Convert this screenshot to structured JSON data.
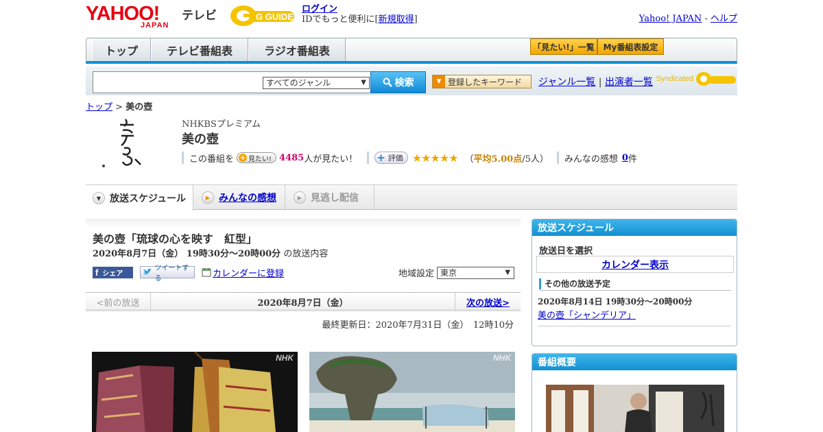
{
  "header": {
    "logo_text": "YAHOO!",
    "logo_sub": "JAPAN",
    "service": "テレビ",
    "partner_logo": "G GUIDE",
    "login": "ログイン",
    "login_desc": "IDでもっと便利に[",
    "signup": "新規取得",
    "login_desc_end": "]",
    "yahoo_japan": "Yahoo! JAPAN",
    "separator": "-",
    "help": "ヘルプ"
  },
  "nav": {
    "tabs": [
      "トップ",
      "テレビ番組表",
      "ラジオ番組表"
    ],
    "mitai_list": "「見たい!」一覧",
    "my_schedule": "My番組表設定"
  },
  "search": {
    "input_value": "",
    "genre": "すべてのジャンル",
    "button": "検索",
    "keyword_button": "登録したキーワード",
    "genre_list": "ジャンル一覧",
    "performers": "出演者一覧",
    "link_sep": "|",
    "syndicated": "Syndicated"
  },
  "breadcrumb": {
    "top": "トップ",
    "sep": ">",
    "current": "美の壺"
  },
  "program": {
    "channel": "NHKBSプレミアム",
    "title": "美の壺",
    "stats_prefix": "この番組を",
    "mitai_btn": "見たい!",
    "mitai_count": "4485",
    "mitai_suffix": "人が見たい！",
    "hyoka": "評価",
    "stars": "★★★★★",
    "avg_open": "（",
    "avg": "平均5.00点",
    "avg_count": "/5人）",
    "impressions_label": "みんなの感想",
    "impressions_count": "0",
    "impressions_unit": "件"
  },
  "subtabs": [
    "放送スケジュール",
    "みんなの感想",
    "見逃し配信"
  ],
  "episode": {
    "title": "美の壺「琉球の心を映す　紅型」",
    "datetime": "2020年8月7日（金） 19時30分～20時00分",
    "datetime_suffix": "の放送内容",
    "fb_share": "シェア",
    "tweet": "ツイートする",
    "calendar": "カレンダーに登録",
    "region_label": "地域設定",
    "region": "東京",
    "prev": "<前の放送",
    "current_date": "2020年8月7日（金）",
    "next": "次の放送>",
    "updated": "最終更新日：2020年7月31日（金）　12時10分",
    "photo_mark": "NHK"
  },
  "sidebar": {
    "schedule_header": "放送スケジュール",
    "select_date": "放送日を選択",
    "calendar_btn": "カレンダー表示",
    "other_header": "その他の放送予定",
    "other": [
      {
        "datetime": "2020年8月14日 19時30分～20時00分",
        "title": "美の壺「シャンデリア」"
      }
    ],
    "summary_header": "番組概要"
  },
  "colors": {
    "accent_blue": "#0a90d6",
    "brand_red": "#e60012",
    "highlight_pink": "#d0006f",
    "star": "#f0a800"
  }
}
